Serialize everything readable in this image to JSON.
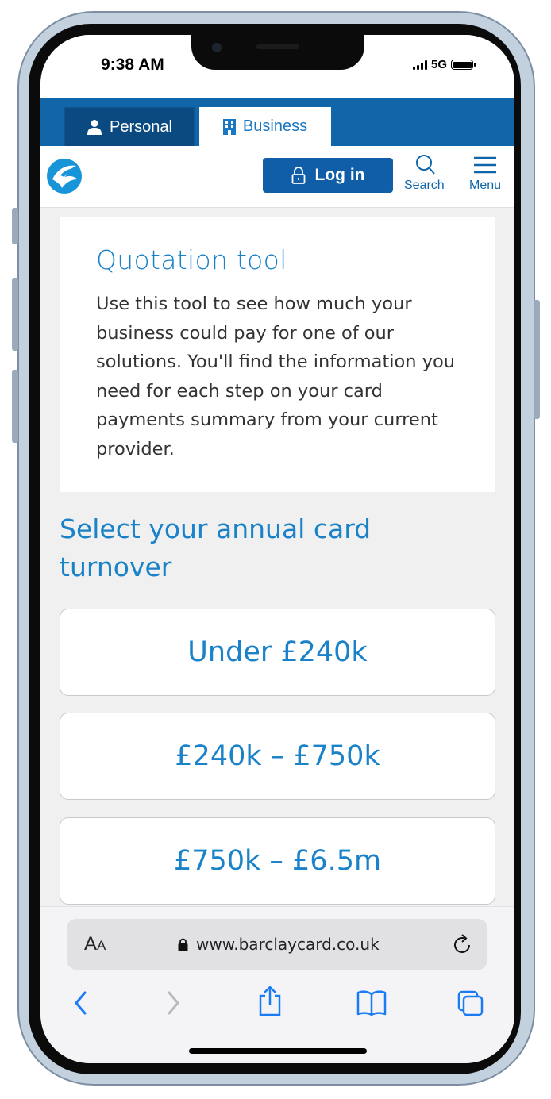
{
  "status_bar": {
    "time": "9:38 AM",
    "network": "5G"
  },
  "site_tabs": {
    "personal": "Personal",
    "business": "Business"
  },
  "header": {
    "login_label": "Log in",
    "search_label": "Search",
    "menu_label": "Menu"
  },
  "intro": {
    "title": "Quotation tool",
    "body": "Use this tool to see how much your business could pay for one of our solutions. You'll find the information you need for each step on your card payments summary from your current provider."
  },
  "turnover": {
    "heading": "Select your annual card turnover",
    "options": [
      "Under £240k",
      "£240k – £750k",
      "£750k – £6.5m"
    ]
  },
  "browser": {
    "text_size_big": "A",
    "text_size_small": "A",
    "url": "www.barclaycard.co.uk"
  },
  "colors": {
    "brand_blue": "#1066a8",
    "accent_text": "#1a82c8",
    "login_bg": "#0f5ea7",
    "safari_blue": "#1a7cf5"
  }
}
